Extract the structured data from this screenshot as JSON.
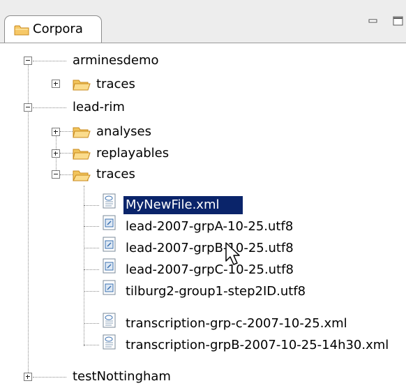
{
  "view": {
    "tab_label": "Corpora",
    "tab_icon": "folder-icon",
    "controls": [
      "minimize-icon",
      "maximize-icon"
    ]
  },
  "tree": {
    "nodes": [
      {
        "label": "arminesdemo",
        "type": "corpus",
        "expanded": true
      },
      {
        "label": "traces",
        "type": "folder",
        "expanded": false
      },
      {
        "label": "lead-rim",
        "type": "corpus",
        "expanded": true
      },
      {
        "label": "analyses",
        "type": "folder",
        "expanded": false
      },
      {
        "label": "replayables",
        "type": "folder",
        "expanded": false
      },
      {
        "label": "traces",
        "type": "folder",
        "expanded": true
      },
      {
        "label": "MyNewFile.xml",
        "type": "xml-file",
        "selected": true
      },
      {
        "label": "lead-2007-grpA-10-25.utf8",
        "type": "text-file"
      },
      {
        "label": "lead-2007-grpB-10-25.utf8",
        "type": "text-file"
      },
      {
        "label": "lead-2007-grpC-10-25.utf8",
        "type": "text-file"
      },
      {
        "label": "tilburg2-group1-step2ID.utf8",
        "type": "text-file"
      },
      {
        "label": "transcription-grp-c-2007-10-25.xml",
        "type": "xml-file"
      },
      {
        "label": "transcription-grpB-2007-10-25-14h30.xml",
        "type": "xml-file"
      },
      {
        "label": "testNottingham",
        "type": "corpus",
        "expanded": false
      }
    ]
  },
  "colors": {
    "selection": "#0a246a",
    "folder": "#f6c867",
    "header": "#ededed"
  }
}
